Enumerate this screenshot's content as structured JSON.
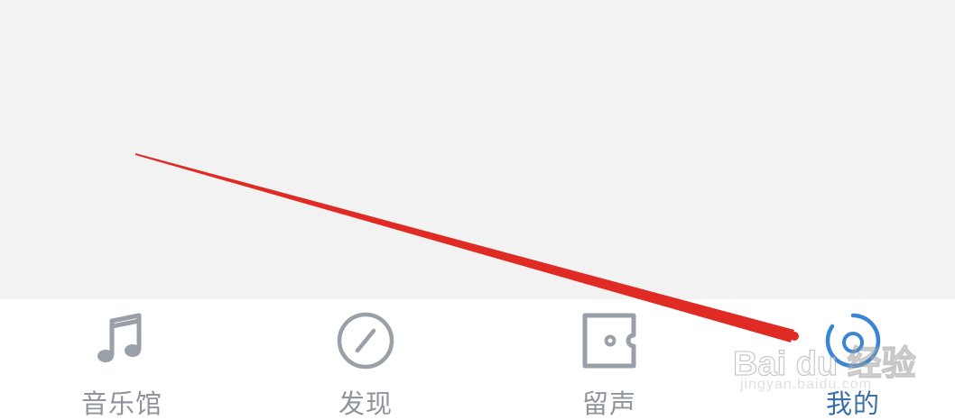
{
  "tab_bar": {
    "items": [
      {
        "label": "音乐馆",
        "icon": "music-note-icon",
        "active": false
      },
      {
        "label": "发现",
        "icon": "compass-slash-icon",
        "active": false
      },
      {
        "label": "留声",
        "icon": "ticket-icon",
        "active": false
      },
      {
        "label": "我的",
        "icon": "profile-icon",
        "active": true
      }
    ],
    "inactive_color": "#8f949c",
    "active_color": "#3a6fa8"
  },
  "annotation": {
    "arrow_color": "#e02b25"
  },
  "watermark": {
    "logo_text": "Bai du 经验",
    "sub_text": "jingyan.baidu.com"
  }
}
